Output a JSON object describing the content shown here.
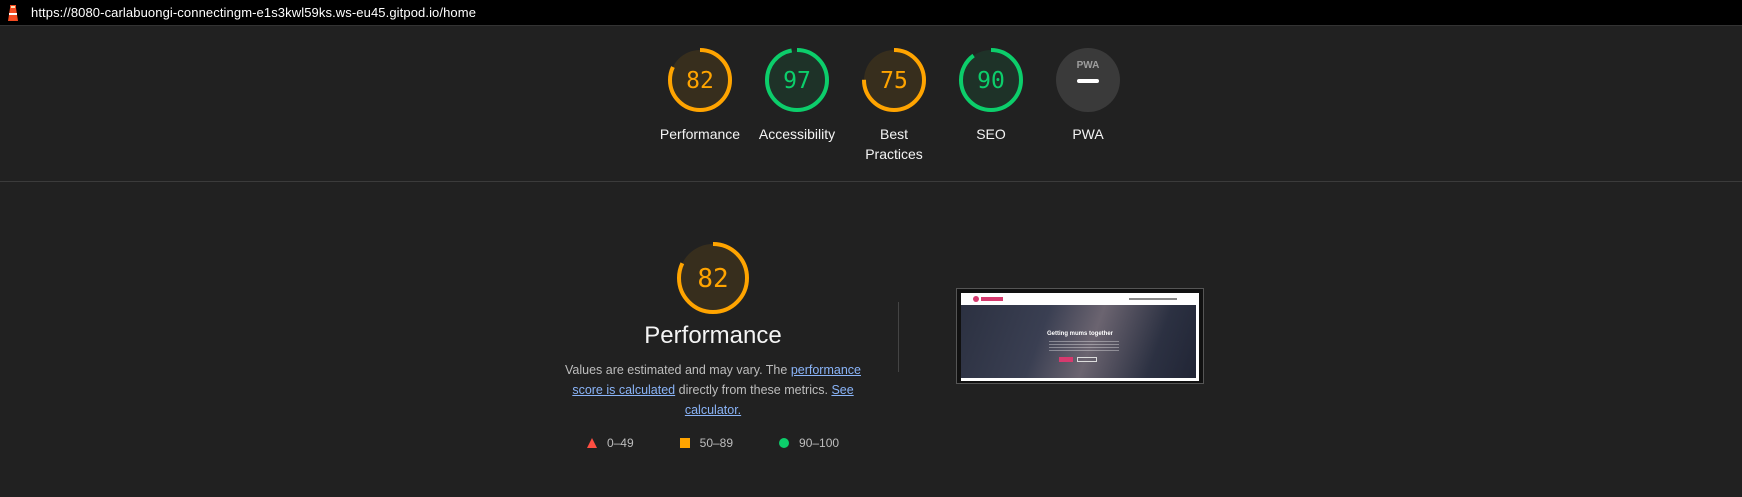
{
  "browser": {
    "url": "https://8080-carlabuongi-connectingm-e1s3kwl59ks.ws-eu45.gitpod.io/home"
  },
  "colors": {
    "fail": "#ff4e42",
    "average": "#ffa400",
    "pass": "#0cce6b",
    "average_text": "#ffa400",
    "pass_text": "#0cce6b",
    "neutral_bg": "#3a3a3a"
  },
  "gauges": [
    {
      "label": "Performance",
      "score": "82",
      "value": 82,
      "rating": "average"
    },
    {
      "label": "Accessibility",
      "score": "97",
      "value": 97,
      "rating": "pass"
    },
    {
      "label": "Best Practices",
      "score": "75",
      "value": 75,
      "rating": "average"
    },
    {
      "label": "SEO",
      "score": "90",
      "value": 90,
      "rating": "pass"
    },
    {
      "label": "PWA",
      "score": "",
      "value": null,
      "rating": "pwa",
      "badge_text": "PWA"
    }
  ],
  "performance": {
    "score": "82",
    "value": 82,
    "title": "Performance",
    "desc_part1": "Values are estimated and may vary. The ",
    "desc_link1": "performance score is calculated",
    "desc_part2": " directly from these metrics. ",
    "desc_link2": "See calculator."
  },
  "legend": {
    "fail": "0–49",
    "average": "50–89",
    "pass": "90–100"
  },
  "screenshot": {
    "heading": "Getting mums together"
  }
}
